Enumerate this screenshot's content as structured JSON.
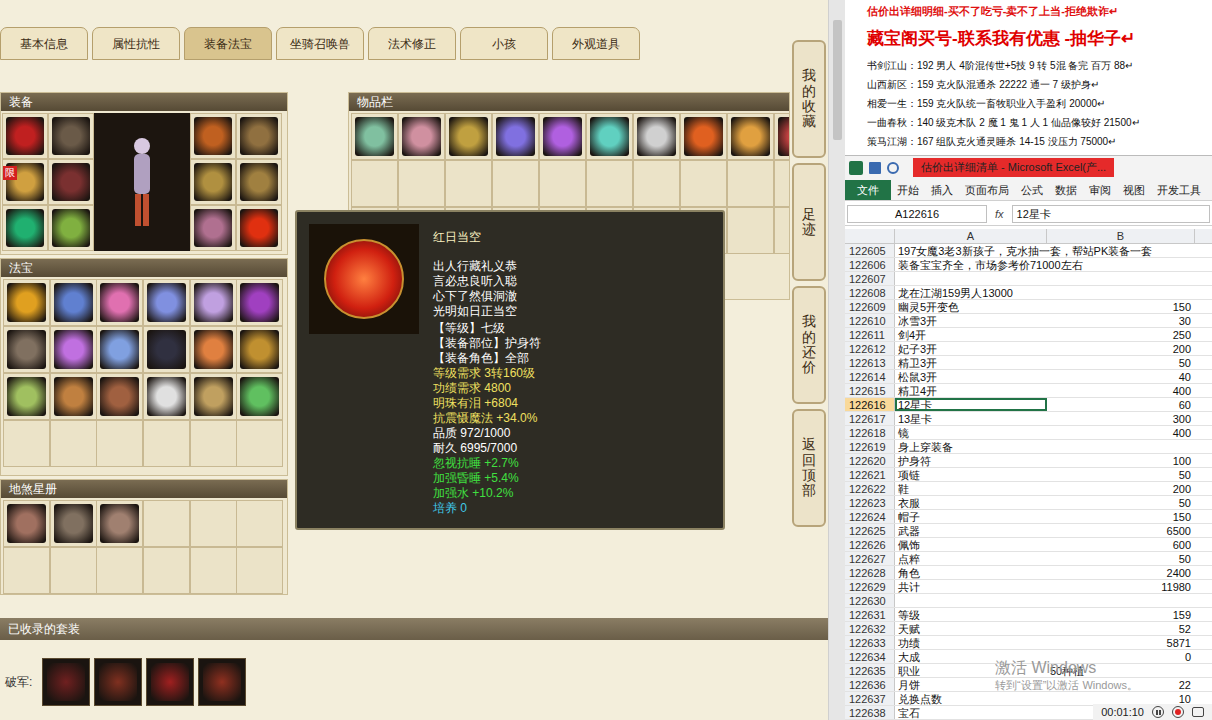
{
  "tabs": [
    {
      "label": "基本信息",
      "selected": false
    },
    {
      "label": "属性抗性",
      "selected": false
    },
    {
      "label": "装备法宝",
      "selected": true
    },
    {
      "label": "坐骑召唤兽",
      "selected": false
    },
    {
      "label": "法术修正",
      "selected": false
    },
    {
      "label": "小孩",
      "selected": false
    },
    {
      "label": "外观道具",
      "selected": false
    }
  ],
  "equipment": {
    "title": "装备",
    "left": [
      {
        "color": "#c02020",
        "badge": ""
      },
      {
        "color": "#6a5a48",
        "badge": ""
      },
      {
        "color": "#d0a040",
        "badge": "限"
      },
      {
        "color": "#7a3030",
        "badge": ""
      },
      {
        "color": "#20b070",
        "badge": ""
      },
      {
        "color": "#80b040",
        "badge": ""
      }
    ],
    "right": [
      {
        "color": "#c06020",
        "badge": ""
      },
      {
        "color": "#907040",
        "badge": ""
      },
      {
        "color": "#b09040",
        "badge": ""
      },
      {
        "color": "#a08040",
        "badge": ""
      },
      {
        "color": "#b07090",
        "badge": ""
      },
      {
        "color": "#e03010",
        "badge": ""
      }
    ]
  },
  "fabao": {
    "title": "法宝",
    "slots": [
      {
        "filled": true,
        "color": "#e0a020"
      },
      {
        "filled": true,
        "color": "#6080d0"
      },
      {
        "filled": true,
        "color": "#e070b0"
      },
      {
        "filled": true,
        "color": "#8090e0"
      },
      {
        "filled": true,
        "color": "#c0a0e0"
      },
      {
        "filled": true,
        "color": "#a040c0"
      },
      {
        "filled": true,
        "color": "#807060"
      },
      {
        "filled": true,
        "color": "#c070e0"
      },
      {
        "filled": true,
        "color": "#80a0e0"
      },
      {
        "filled": true,
        "color": "#303040"
      },
      {
        "filled": true,
        "color": "#e08040"
      },
      {
        "filled": true,
        "color": "#c09030"
      },
      {
        "filled": true,
        "color": "#a0c060"
      },
      {
        "filled": true,
        "color": "#c08040"
      },
      {
        "filled": true,
        "color": "#a06040"
      },
      {
        "filled": true,
        "color": "#e0e0e0"
      },
      {
        "filled": true,
        "color": "#c0a060"
      },
      {
        "filled": true,
        "color": "#60c060"
      },
      {
        "filled": false,
        "color": "#000000"
      },
      {
        "filled": false,
        "color": "#000000"
      },
      {
        "filled": false,
        "color": "#000000"
      },
      {
        "filled": false,
        "color": "#000000"
      },
      {
        "filled": false,
        "color": "#000000"
      },
      {
        "filled": false,
        "color": "#000000"
      }
    ]
  },
  "dishaxing": {
    "title": "地煞星册",
    "slots": [
      {
        "filled": true,
        "color": "#a07060"
      },
      {
        "filled": true,
        "color": "#807060"
      },
      {
        "filled": true,
        "color": "#a08070"
      },
      {
        "filled": false,
        "color": "#000000"
      },
      {
        "filled": false,
        "color": "#000000"
      },
      {
        "filled": false,
        "color": "#000000"
      },
      {
        "filled": false,
        "color": "#000000"
      },
      {
        "filled": false,
        "color": "#000000"
      },
      {
        "filled": false,
        "color": "#000000"
      },
      {
        "filled": false,
        "color": "#000000"
      },
      {
        "filled": false,
        "color": "#000000"
      },
      {
        "filled": false,
        "color": "#000000"
      }
    ]
  },
  "inventory": {
    "title": "物品栏",
    "slots": [
      {
        "filled": true,
        "color": "#80c0a0"
      },
      {
        "filled": true,
        "color": "#d090a0"
      },
      {
        "filled": true,
        "color": "#c0a040"
      },
      {
        "filled": true,
        "color": "#8070e0"
      },
      {
        "filled": true,
        "color": "#b060e0"
      },
      {
        "filled": true,
        "color": "#60d0c0"
      },
      {
        "filled": true,
        "color": "#d0d0d0"
      },
      {
        "filled": true,
        "color": "#e06020"
      },
      {
        "filled": true,
        "color": "#e0a040"
      },
      {
        "filled": true,
        "color": "#c04040"
      },
      {
        "filled": false,
        "color": "#000000"
      },
      {
        "filled": false,
        "color": "#000000"
      },
      {
        "filled": false,
        "color": "#000000"
      },
      {
        "filled": false,
        "color": "#000000"
      },
      {
        "filled": false,
        "color": "#000000"
      },
      {
        "filled": false,
        "color": "#000000"
      },
      {
        "filled": false,
        "color": "#000000"
      },
      {
        "filled": false,
        "color": "#000000"
      },
      {
        "filled": false,
        "color": "#000000"
      },
      {
        "filled": false,
        "color": "#000000"
      },
      {
        "filled": false,
        "color": "#000000"
      },
      {
        "filled": false,
        "color": "#000000"
      },
      {
        "filled": false,
        "color": "#000000"
      },
      {
        "filled": false,
        "color": "#000000"
      },
      {
        "filled": false,
        "color": "#000000"
      },
      {
        "filled": false,
        "color": "#000000"
      },
      {
        "filled": false,
        "color": "#000000"
      },
      {
        "filled": false,
        "color": "#000000"
      },
      {
        "filled": false,
        "color": "#000000"
      },
      {
        "filled": false,
        "color": "#000000"
      }
    ]
  },
  "tooltip": {
    "title": "红日当空",
    "poem": [
      "出人行藏礼义恭",
      "言必忠良听入聪",
      "心下了然俱洞澈",
      "光明如日正当空"
    ],
    "info": [
      "【等级】七级",
      "【装备部位】护身符",
      "【装备角色】全部"
    ],
    "stats": [
      {
        "text": "等级需求 3转160级",
        "color": "#f0e060"
      },
      {
        "text": "功绩需求 4800",
        "color": "#f0e060"
      },
      {
        "text": "明珠有泪 +6804",
        "color": "#f0e060"
      },
      {
        "text": "抗震慑魔法 +34.0%",
        "color": "#f0e060"
      },
      {
        "text": "品质 972/1000",
        "color": "#ffffff"
      },
      {
        "text": "耐久 6995/7000",
        "color": "#ffffff"
      },
      {
        "text": "忽视抗睡 +2.7%",
        "color": "#40e040"
      },
      {
        "text": "加强昏睡 +5.4%",
        "color": "#40e040"
      },
      {
        "text": "加强水 +10.2%",
        "color": "#40e040"
      },
      {
        "text": "培养 0",
        "color": "#40c8e8"
      }
    ]
  },
  "sidebar": [
    "我的收藏",
    "足迹",
    "我的还价",
    "返回顶部"
  ],
  "suits": {
    "title": "已收录的套装",
    "label": "破军:",
    "items": [
      "#702020",
      "#803020",
      "#a02020",
      "#903020"
    ]
  },
  "notes": {
    "notice": "估价出详细明细-买不了吃亏-卖不了上当-拒绝欺诈↵",
    "headline": "藏宝阁买号-联系我有优惠 -抽华子↵",
    "lines": [
      "书剑江山：192 男人 4阶混传世+5技 9 转 5混 备完 百万 88↵",
      "山西新区：159 克火队混通杀 22222 通一 7 级护身↵",
      "相爱一生：159 克火队统一畜牧职业入手盈利 20000↵",
      "一曲春秋：140 级克木队 2 魔 1 鬼 1 人 1 仙品像较好 21500↵",
      "策马江湖：167 组队克火通灵睡杀 14-15 没压力 75000↵"
    ]
  },
  "excel": {
    "title": "估价出详细清单 - Microsoft Excel(产...",
    "menu": [
      {
        "label": "文件",
        "selected": true
      },
      {
        "label": "开始",
        "selected": false
      },
      {
        "label": "插入",
        "selected": false
      },
      {
        "label": "页面布局",
        "selected": false
      },
      {
        "label": "公式",
        "selected": false
      },
      {
        "label": "数据",
        "selected": false
      },
      {
        "label": "审阅",
        "selected": false
      },
      {
        "label": "视图",
        "selected": false
      },
      {
        "label": "开发工具",
        "selected": false
      }
    ],
    "name_box": "A122616",
    "fx": "fx",
    "formula": "12星卡",
    "columns": [
      "A",
      "B"
    ],
    "rows": [
      {
        "n": "122605",
        "a": "197女魔3老3新孩子，克水抽一套，帮站PK装备一套",
        "b": "",
        "kind": "number",
        "selected": false
      },
      {
        "n": "122606",
        "a": "装备宝宝齐全，市场参考价71000左右",
        "b": "",
        "kind": "number",
        "selected": false
      },
      {
        "n": "122607",
        "a": "",
        "b": "",
        "kind": "number",
        "selected": false
      },
      {
        "n": "122608",
        "a": "龙在江湖159男人13000",
        "b": "",
        "kind": "number",
        "selected": false
      },
      {
        "n": "122609",
        "a": "幽灵5开变色",
        "b": "150",
        "kind": "number",
        "selected": false
      },
      {
        "n": "122610",
        "a": "冰雪3开",
        "b": "30",
        "kind": "number",
        "selected": false
      },
      {
        "n": "122611",
        "a": "剑4开",
        "b": "250",
        "kind": "number",
        "selected": false
      },
      {
        "n": "122612",
        "a": "妃子3开",
        "b": "200",
        "kind": "number",
        "selected": false
      },
      {
        "n": "122613",
        "a": "精卫3开",
        "b": "50",
        "kind": "number",
        "selected": false
      },
      {
        "n": "122614",
        "a": "松鼠3开",
        "b": "40",
        "kind": "number",
        "selected": false
      },
      {
        "n": "122615",
        "a": "精卫4开",
        "b": "400",
        "kind": "number",
        "selected": false
      },
      {
        "n": "122616",
        "a": "12星卡",
        "b": "60",
        "kind": "number",
        "selected": true
      },
      {
        "n": "122617",
        "a": "13星卡",
        "b": "300",
        "kind": "number",
        "selected": false
      },
      {
        "n": "122618",
        "a": "镜",
        "b": "400",
        "kind": "number",
        "selected": false
      },
      {
        "n": "122619",
        "a": "身上穿装备",
        "b": "",
        "kind": "number",
        "selected": false
      },
      {
        "n": "122620",
        "a": "护身符",
        "b": "100",
        "kind": "number",
        "selected": false
      },
      {
        "n": "122621",
        "a": "项链",
        "b": "50",
        "kind": "number",
        "selected": false
      },
      {
        "n": "122622",
        "a": "鞋",
        "b": "200",
        "kind": "number",
        "selected": false
      },
      {
        "n": "122623",
        "a": "衣服",
        "b": "50",
        "kind": "number",
        "selected": false
      },
      {
        "n": "122624",
        "a": "帽子",
        "b": "150",
        "kind": "number",
        "selected": false
      },
      {
        "n": "122625",
        "a": "武器",
        "b": "6500",
        "kind": "number",
        "selected": false
      },
      {
        "n": "122626",
        "a": "佩饰",
        "b": "600",
        "kind": "number",
        "selected": false
      },
      {
        "n": "122627",
        "a": "点粹",
        "b": "50",
        "kind": "number",
        "selected": false
      },
      {
        "n": "122628",
        "a": "角色",
        "b": "2400",
        "kind": "number",
        "selected": false
      },
      {
        "n": "122629",
        "a": "共计",
        "b": "11980",
        "kind": "number",
        "selected": false
      },
      {
        "n": "122630",
        "a": "",
        "b": "",
        "kind": "number",
        "selected": false
      },
      {
        "n": "122631",
        "a": "等级",
        "b": "159",
        "kind": "number",
        "selected": false
      },
      {
        "n": "122632",
        "a": "天赋",
        "b": "52",
        "kind": "number",
        "selected": false
      },
      {
        "n": "122633",
        "a": "功绩",
        "b": "5871",
        "kind": "number",
        "selected": false
      },
      {
        "n": "122634",
        "a": "大成",
        "b": "0",
        "kind": "number",
        "selected": false
      },
      {
        "n": "122635",
        "a": "职业",
        "b": "50种植",
        "kind": "text",
        "selected": false
      },
      {
        "n": "122636",
        "a": "月饼",
        "b": "22",
        "kind": "number",
        "selected": false
      },
      {
        "n": "122637",
        "a": "兑换点数",
        "b": "10",
        "kind": "number",
        "selected": false
      },
      {
        "n": "122638",
        "a": "宝石",
        "b": "",
        "kind": "number",
        "selected": false
      }
    ]
  },
  "watermark": {
    "title": "激活 Windows",
    "subtitle": "转到“设置”以激活 Windows。"
  },
  "recorder": {
    "time": "00:01:10"
  }
}
